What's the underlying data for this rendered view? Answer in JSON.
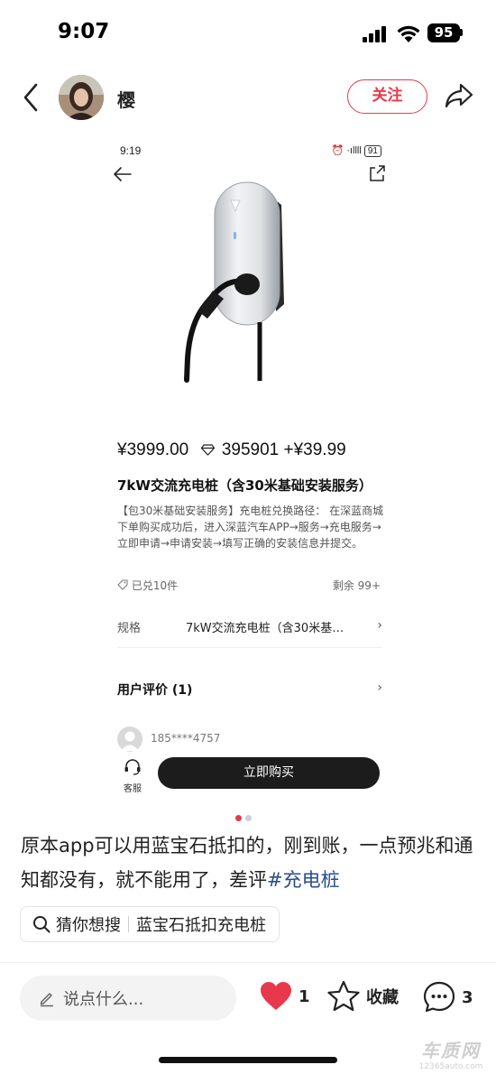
{
  "status_bar": {
    "time": "9:07",
    "battery": "95"
  },
  "header": {
    "author_name": "樱",
    "follow_label": "关注"
  },
  "screenshot": {
    "status_time": "9:19",
    "status_battery": "91",
    "price": "¥3999.00",
    "points": "395901",
    "extra_price": "+¥39.99",
    "product_title": "7kW交流充电桩（含30米基础安装服务）",
    "product_desc": "【包30米基础安装服务】充电桩兑换路径： 在深蓝商城下单购买成功后，进入深蓝汽车APP→服务→充电服务→立即申请→申请安装→填写正确的安装信息并提交。",
    "redeemed": "已兑10件",
    "remaining": "剩余 99+",
    "spec_label": "规格",
    "spec_value": "7kW交流充电桩（含30米基…",
    "reviews_label": "用户评价 (1)",
    "reviewer_name": "185****4757",
    "service_label": "客服",
    "buy_label": "立即购买"
  },
  "post": {
    "text": "原本app可以用蓝宝石抵扣的，刚到账，一点预兆和通知都没有，就不能用了，差评",
    "hashtag": "#充电桩"
  },
  "search_suggestion": {
    "prefix": "猜你想搜",
    "query": "蓝宝石抵扣充电桩"
  },
  "bottom_bar": {
    "comment_placeholder": "说点什么...",
    "like_count": "1",
    "favorite_label": "收藏",
    "comment_count": "3"
  },
  "watermark": {
    "logo": "车质网",
    "url": "12365auto.com"
  },
  "colors": {
    "accent": "#e8384b",
    "hashtag": "#2a4e8a",
    "button_dark": "#1c1c1c"
  }
}
